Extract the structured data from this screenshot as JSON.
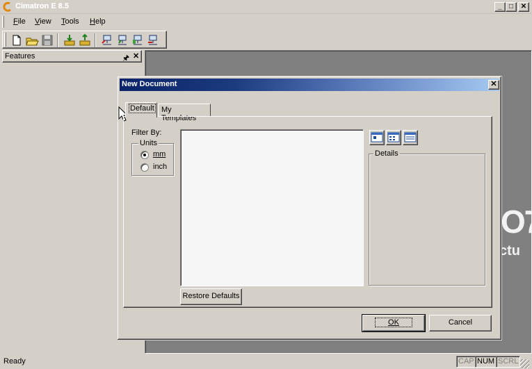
{
  "app": {
    "title": "Cimatron E 8.5"
  },
  "window_controls": {
    "minimize": "_",
    "maximize": "□",
    "close": "✕"
  },
  "menu": [
    {
      "label": "File",
      "mnemonic": "F",
      "rest": "ile"
    },
    {
      "label": "View",
      "mnemonic": "V",
      "rest": "iew"
    },
    {
      "label": "Tools",
      "mnemonic": "T",
      "rest": "ools"
    },
    {
      "label": "Help",
      "mnemonic": "H",
      "rest": "elp"
    }
  ],
  "toolbar": {
    "buttons": [
      {
        "name": "new-document",
        "icon": "new-file-icon"
      },
      {
        "name": "open",
        "icon": "open-folder-icon"
      },
      {
        "name": "save",
        "icon": "save-disk-icon"
      },
      {
        "name": "import",
        "icon": "import-icon"
      },
      {
        "name": "export",
        "icon": "export-icon"
      },
      {
        "name": "network-1",
        "icon": "network-icon"
      },
      {
        "name": "network-2",
        "icon": "network-icon"
      },
      {
        "name": "network-3",
        "icon": "network-icon"
      },
      {
        "name": "network-4",
        "icon": "network-icon"
      }
    ]
  },
  "features_pane": {
    "title": "Features",
    "pin": "🖈",
    "close": "✕"
  },
  "dialog": {
    "title": "New Document",
    "close": "✕",
    "tabs": [
      {
        "label": "Default",
        "active": true
      },
      {
        "label": "My Templates",
        "active": false
      }
    ],
    "filter_label": "Filter By:",
    "units": {
      "legend": "Units",
      "options": [
        {
          "label": "mm",
          "selected": true
        },
        {
          "label": "inch",
          "selected": false
        }
      ]
    },
    "restore_button": "Restore Defaults",
    "details_legend": "Details",
    "view_buttons": [
      "large-icons-view-icon",
      "small-icons-view-icon",
      "details-view-icon"
    ],
    "ok_button": "OK",
    "cancel_button": "Cancel"
  },
  "background_brand": {
    "mark": "O7",
    "tag": "ctu"
  },
  "statusbar": {
    "text": "Ready",
    "indicators": [
      "CAP",
      "NUM",
      "SCRL"
    ],
    "active_indicator": "NUM"
  }
}
